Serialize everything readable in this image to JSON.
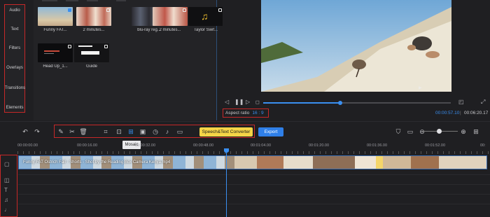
{
  "sidebar": {
    "items": [
      {
        "label": "Audio",
        "icon": "audio-icon"
      },
      {
        "label": "Text",
        "icon": "text-icon"
      },
      {
        "label": "Filters",
        "icon": "filter-icon"
      },
      {
        "label": "Overlays",
        "icon": "overlay-icon"
      },
      {
        "label": "Transitions",
        "icon": "transition-icon"
      },
      {
        "label": "Elements",
        "icon": "element-icon"
      }
    ]
  },
  "media": {
    "items": [
      {
        "label": "Funny FAT..."
      },
      {
        "label": "2 minutes..."
      },
      {
        "label": "blu-ray reg..."
      },
      {
        "label": "2 minutes..."
      },
      {
        "label": "Taylor Swif..."
      },
      {
        "label": "Head Up_1..."
      },
      {
        "label": "Guide"
      }
    ]
  },
  "player": {
    "aspect_label": "Aspect ratio",
    "aspect_value": "16 : 9",
    "current_time": "00:00:57.10",
    "separator": "|",
    "total_time": "00:06:20.17",
    "progress": 0.41
  },
  "toolbar": {
    "speech_label": "Speech&Text Converter",
    "export_label": "Export",
    "tooltip": "Mosaic",
    "zoom": 0.48
  },
  "timeline": {
    "ruler": [
      "00:00:00.00",
      "00:00:16.00",
      "00:00:32.00",
      "00:00:48.00",
      "00:01:04.00",
      "00:01:20.00",
      "00:01:36.00",
      "00:01:52.00",
      "00:"
    ],
    "clip_title": "Funny FAT Ostrich Fail - Shorts - Shot by the Reading Box Camera Kenya.mp4"
  },
  "colors": {
    "accent": "#3a8ff0",
    "highlight": "#c62828",
    "speech_button": "#f5d547"
  }
}
